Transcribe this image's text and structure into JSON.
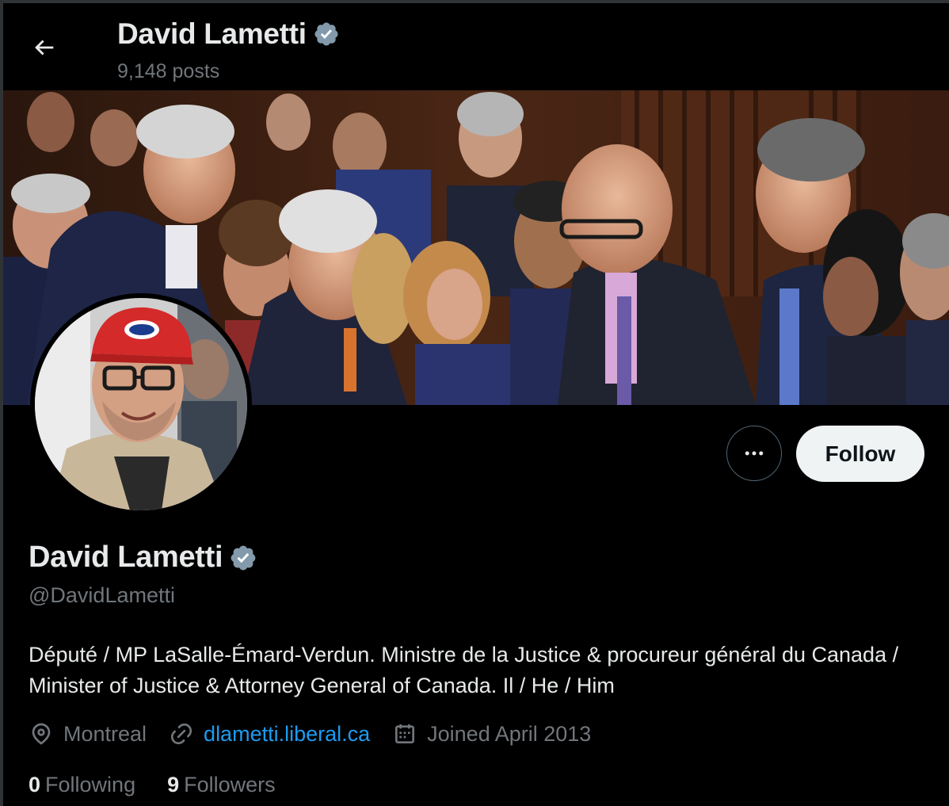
{
  "header": {
    "name": "David Lametti",
    "posts": "9,148 posts"
  },
  "icons": {
    "back": "arrow-left-icon",
    "verified": "verified-badge-icon",
    "more": "more-horizontal-icon",
    "location": "location-pin-icon",
    "link": "link-icon",
    "calendar": "calendar-icon"
  },
  "actions": {
    "more_label": "•••",
    "follow_label": "Follow"
  },
  "profile": {
    "name": "David Lametti",
    "handle": "@DavidLametti",
    "bio": "Député / MP LaSalle-Émard-Verdun. Ministre de la Justice & procureur général du Canada / Minister of Justice & Attorney General of Canada. Il / He / Him",
    "location": "Montreal",
    "website": "dlametti.liberal.ca",
    "joined": "Joined April 2013",
    "following_count": "0",
    "following_label": "Following",
    "followers_count": "9",
    "followers_label": "Followers"
  },
  "colors": {
    "background": "#000000",
    "text_primary": "#e7e9ea",
    "text_secondary": "#71767b",
    "link": "#1d9bf0",
    "verified_badge": "#829aab",
    "follow_button_bg": "#eff3f4"
  }
}
